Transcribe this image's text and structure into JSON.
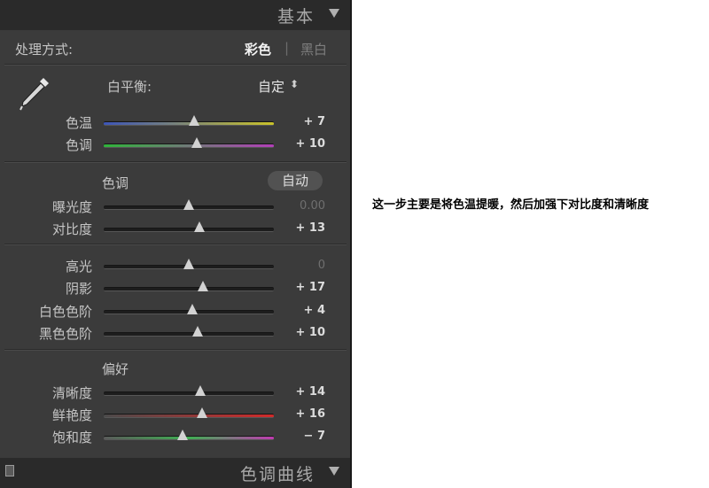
{
  "header": {
    "title": "基本"
  },
  "footer": {
    "title": "色调曲线"
  },
  "treatment": {
    "label": "处理方式:",
    "color": "彩色",
    "bw": "黑白",
    "divider": "|"
  },
  "wb": {
    "label": "白平衡:",
    "value": "自定",
    "arrow": "⬍"
  },
  "sections": {
    "tone": {
      "title": "色调",
      "auto": "自动"
    },
    "presence": {
      "title": "偏好"
    }
  },
  "sliders": [
    {
      "id": "temp",
      "label": "色温",
      "value": "+ 7",
      "pos": 0.53,
      "dim": false,
      "gradient": [
        "#3d55b8",
        "#c9c22a"
      ]
    },
    {
      "id": "tint",
      "label": "色调",
      "value": "+ 10",
      "pos": 0.545,
      "dim": false,
      "gradient": [
        "#2fb43a",
        "#b23fb8"
      ]
    },
    {
      "id": "exposure",
      "label": "曝光度",
      "value": "0.00",
      "pos": 0.5,
      "dim": true,
      "gradient": null
    },
    {
      "id": "contrast",
      "label": "对比度",
      "value": "+ 13",
      "pos": 0.565,
      "dim": false,
      "gradient": null
    },
    {
      "id": "highlights",
      "label": "高光",
      "value": "0",
      "pos": 0.5,
      "dim": true,
      "gradient": null
    },
    {
      "id": "shadows",
      "label": "阴影",
      "value": "+ 17",
      "pos": 0.585,
      "dim": false,
      "gradient": null
    },
    {
      "id": "whites",
      "label": "白色色阶",
      "value": "+ 4",
      "pos": 0.52,
      "dim": false,
      "gradient": null
    },
    {
      "id": "blacks",
      "label": "黑色色阶",
      "value": "+ 10",
      "pos": 0.55,
      "dim": false,
      "gradient": null
    },
    {
      "id": "clarity",
      "label": "清晰度",
      "value": "+ 14",
      "pos": 0.57,
      "dim": false,
      "gradient": null
    },
    {
      "id": "vibrance",
      "label": "鲜艳度",
      "value": "+ 16",
      "pos": 0.58,
      "dim": false,
      "gradient": [
        "#4a4a4a",
        "#d02a2a"
      ]
    },
    {
      "id": "saturation",
      "label": "饱和度",
      "value": "− 7",
      "pos": 0.465,
      "dim": false,
      "gradient": [
        "#5a5a5a",
        "#3fae52",
        "#c03ab0"
      ]
    }
  ],
  "annotation": "这一步主要是将色温提暖，然后加强下对比度和清晰度"
}
